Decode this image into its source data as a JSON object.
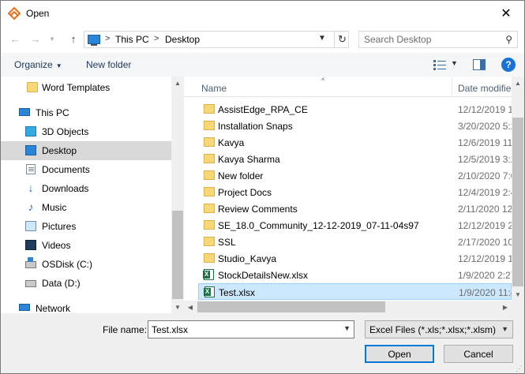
{
  "window": {
    "title": "Open",
    "close_symbol": "✕"
  },
  "address": {
    "crumbs": [
      "This PC",
      "Desktop"
    ],
    "separator": ">"
  },
  "search": {
    "placeholder": "Search Desktop"
  },
  "toolbar": {
    "organize_label": "Organize",
    "new_folder_label": "New folder",
    "help_label": "?"
  },
  "nav": {
    "items": [
      {
        "label": "Word Templates",
        "icon": "folder-icon"
      },
      {
        "label": "This PC",
        "icon": "computer-icon"
      },
      {
        "label": "3D Objects",
        "icon": "cube-icon"
      },
      {
        "label": "Desktop",
        "icon": "desktop-icon",
        "selected": true
      },
      {
        "label": "Documents",
        "icon": "document-icon"
      },
      {
        "label": "Downloads",
        "icon": "download-icon"
      },
      {
        "label": "Music",
        "icon": "music-icon"
      },
      {
        "label": "Pictures",
        "icon": "pictures-icon"
      },
      {
        "label": "Videos",
        "icon": "video-icon"
      },
      {
        "label": "OSDisk (C:)",
        "icon": "disk-icon"
      },
      {
        "label": "Data (D:)",
        "icon": "disk-icon"
      },
      {
        "label": "Network",
        "icon": "network-icon"
      }
    ]
  },
  "files": {
    "columns": {
      "name": "Name",
      "date": "Date modified"
    },
    "rows": [
      {
        "name": "AssistEdge_RPA_CE",
        "date": "12/12/2019 12:",
        "type": "folder"
      },
      {
        "name": "Installation Snaps",
        "date": "3/20/2020 5:2",
        "type": "folder"
      },
      {
        "name": "Kavya",
        "date": "12/6/2019 11:",
        "type": "folder"
      },
      {
        "name": "Kavya Sharma",
        "date": "12/5/2019 3:2",
        "type": "folder"
      },
      {
        "name": "New folder",
        "date": "2/10/2020 7:0",
        "type": "folder"
      },
      {
        "name": "Project Docs",
        "date": "12/4/2019 2:4",
        "type": "folder"
      },
      {
        "name": "Review Comments",
        "date": "2/11/2020 12:",
        "type": "folder"
      },
      {
        "name": "SE_18.0_Community_12-12-2019_07-11-04s97",
        "date": "12/12/2019 2:",
        "type": "folder"
      },
      {
        "name": "SSL",
        "date": "2/17/2020 10:",
        "type": "folder"
      },
      {
        "name": "Studio_Kavya",
        "date": "12/12/2019 12:",
        "type": "folder"
      },
      {
        "name": "StockDetailsNew.xlsx",
        "date": "1/9/2020 2:27",
        "type": "excel"
      },
      {
        "name": "Test.xlsx",
        "date": "1/9/2020 11:4",
        "type": "excel",
        "selected": true
      }
    ]
  },
  "bottom": {
    "file_name_label": "File name:",
    "file_name_value": "Test.xlsx",
    "file_type": "Excel Files (*.xls;*.xlsx;*.xlsm)",
    "open_label": "Open",
    "cancel_label": "Cancel"
  },
  "colors": {
    "accent": "#0078d7",
    "selection": "#cce8ff",
    "nav_selected": "#d9d9d9",
    "folder": "#f8d775"
  }
}
